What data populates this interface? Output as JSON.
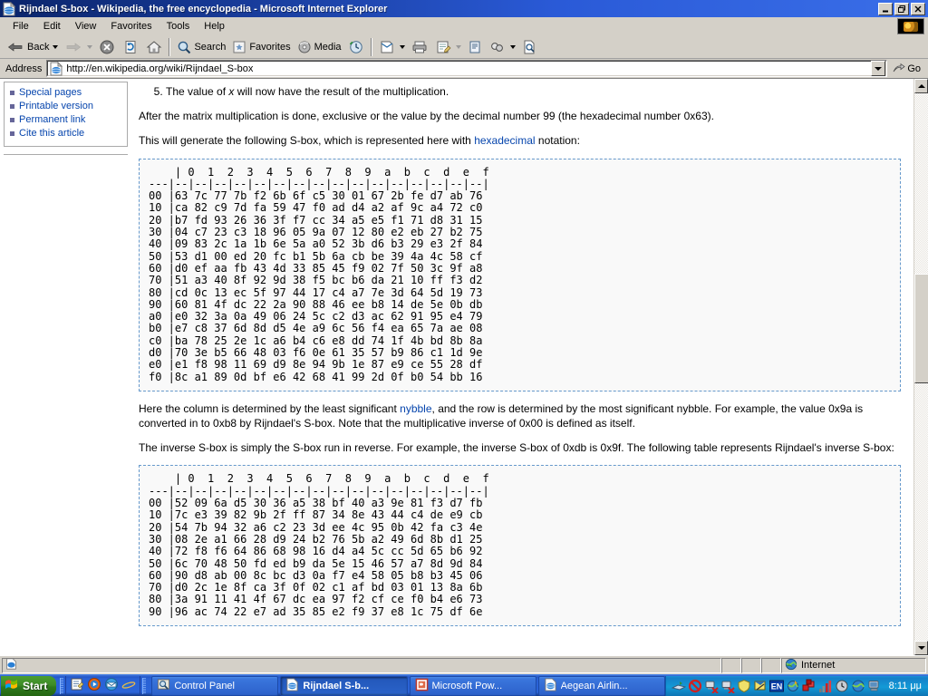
{
  "window": {
    "title": "Rijndael S-box - Wikipedia, the free encyclopedia - Microsoft Internet Explorer",
    "icon": "ie-document-icon",
    "minimize_label": "_",
    "maximize_label": "❐",
    "close_label": "✕"
  },
  "menu": {
    "items": [
      {
        "label": "File"
      },
      {
        "label": "Edit"
      },
      {
        "label": "View"
      },
      {
        "label": "Favorites"
      },
      {
        "label": "Tools"
      },
      {
        "label": "Help"
      }
    ]
  },
  "toolbar": {
    "back_label": "Back",
    "forward_label": "",
    "stop_label": "",
    "refresh_label": "",
    "home_label": "",
    "search_label": "Search",
    "favorites_label": "Favorites",
    "media_label": "Media",
    "history_label": "",
    "mail_label": "",
    "print_label": "",
    "edit_label": "",
    "discuss_label": "",
    "messenger_label": "",
    "research_label": ""
  },
  "address_bar": {
    "label": "Address",
    "url": "http://en.wikipedia.org/wiki/Rijndael_S-box",
    "placeholder": "",
    "go_label": "Go"
  },
  "sidebar": {
    "items": [
      {
        "label": "Special pages"
      },
      {
        "label": "Printable version"
      },
      {
        "label": "Permanent link"
      },
      {
        "label": "Cite this article"
      }
    ]
  },
  "article": {
    "step5_number": "5.",
    "step5_text_a": "The value of ",
    "step5_var": "x",
    "step5_text_b": " will now have the result of the multiplication.",
    "para_after_matrix": "After the matrix multiplication is done, exclusive or the value by the decimal number 99 (the hexadecimal number 0x63).",
    "para_generate_a": "This will generate the following S-box, which is represented here with ",
    "para_generate_link": "hexadecimal",
    "para_generate_b": " notation:",
    "para_column_a": "Here the column is determined by the least significant ",
    "para_column_link": "nybble",
    "para_column_b": ", and the row is determined by the most significant nybble. For example, the value 0x9a is converted in to 0xb8 by Rijndael's S-box. Note that the multiplicative inverse of 0x00 is defined as itself.",
    "para_inverse": "The inverse S-box is simply the S-box run in reverse. For example, the inverse S-box of 0xdb is 0x9f. The following table represents Rijndael's inverse S-box:",
    "sbox_text": "    | 0  1  2  3  4  5  6  7  8  9  a  b  c  d  e  f\n---|--|--|--|--|--|--|--|--|--|--|--|--|--|--|--|--|\n00 |63 7c 77 7b f2 6b 6f c5 30 01 67 2b fe d7 ab 76\n10 |ca 82 c9 7d fa 59 47 f0 ad d4 a2 af 9c a4 72 c0\n20 |b7 fd 93 26 36 3f f7 cc 34 a5 e5 f1 71 d8 31 15\n30 |04 c7 23 c3 18 96 05 9a 07 12 80 e2 eb 27 b2 75\n40 |09 83 2c 1a 1b 6e 5a a0 52 3b d6 b3 29 e3 2f 84\n50 |53 d1 00 ed 20 fc b1 5b 6a cb be 39 4a 4c 58 cf\n60 |d0 ef aa fb 43 4d 33 85 45 f9 02 7f 50 3c 9f a8\n70 |51 a3 40 8f 92 9d 38 f5 bc b6 da 21 10 ff f3 d2\n80 |cd 0c 13 ec 5f 97 44 17 c4 a7 7e 3d 64 5d 19 73\n90 |60 81 4f dc 22 2a 90 88 46 ee b8 14 de 5e 0b db\na0 |e0 32 3a 0a 49 06 24 5c c2 d3 ac 62 91 95 e4 79\nb0 |e7 c8 37 6d 8d d5 4e a9 6c 56 f4 ea 65 7a ae 08\nc0 |ba 78 25 2e 1c a6 b4 c6 e8 dd 74 1f 4b bd 8b 8a\nd0 |70 3e b5 66 48 03 f6 0e 61 35 57 b9 86 c1 1d 9e\ne0 |e1 f8 98 11 69 d9 8e 94 9b 1e 87 e9 ce 55 28 df\nf0 |8c a1 89 0d bf e6 42 68 41 99 2d 0f b0 54 bb 16",
    "inv_sbox_text": "    | 0  1  2  3  4  5  6  7  8  9  a  b  c  d  e  f\n---|--|--|--|--|--|--|--|--|--|--|--|--|--|--|--|--|\n00 |52 09 6a d5 30 36 a5 38 bf 40 a3 9e 81 f3 d7 fb\n10 |7c e3 39 82 9b 2f ff 87 34 8e 43 44 c4 de e9 cb\n20 |54 7b 94 32 a6 c2 23 3d ee 4c 95 0b 42 fa c3 4e\n30 |08 2e a1 66 28 d9 24 b2 76 5b a2 49 6d 8b d1 25\n40 |72 f8 f6 64 86 68 98 16 d4 a4 5c cc 5d 65 b6 92\n50 |6c 70 48 50 fd ed b9 da 5e 15 46 57 a7 8d 9d 84\n60 |90 d8 ab 00 8c bc d3 0a f7 e4 58 05 b8 b3 45 06\n70 |d0 2c 1e 8f ca 3f 0f 02 c1 af bd 03 01 13 8a 6b\n80 |3a 91 11 41 4f 67 dc ea 97 f2 cf ce f0 b4 e6 73\n90 |96 ac 74 22 e7 ad 35 85 e2 f9 37 e8 1c 75 df 6e"
  },
  "scrollbar": {
    "up_label": "▲",
    "down_label": "▼",
    "thumb_top_pct": 33,
    "thumb_height_pct": 20
  },
  "status_bar": {
    "message": "",
    "zone": "Internet",
    "zone_icon": "globe-icon"
  },
  "taskbar": {
    "start_label": "Start",
    "quick_launch": [
      {
        "name": "show-desktop-icon"
      },
      {
        "name": "media-player-icon"
      },
      {
        "name": "outlook-express-icon"
      },
      {
        "name": "internet-explorer-icon"
      }
    ],
    "tasks": [
      {
        "label": "Control Panel",
        "icon": "control-panel-icon",
        "active": false
      },
      {
        "label": "Rijndael S-b...",
        "icon": "ie-icon",
        "active": true
      },
      {
        "label": "Microsoft Pow...",
        "icon": "powerpoint-icon",
        "active": false
      },
      {
        "label": "Aegean Airlin...",
        "icon": "ie-icon",
        "active": false
      }
    ],
    "tray_icons": [
      {
        "name": "safely-remove-hardware-icon"
      },
      {
        "name": "blocked-icon"
      },
      {
        "name": "network-disconnected-icon"
      },
      {
        "name": "network-disconnected-2-icon"
      },
      {
        "name": "shield-icon"
      },
      {
        "name": "notes-icon"
      },
      {
        "name": "language-bar-en-icon",
        "label": "EN"
      },
      {
        "name": "antivirus-icon"
      },
      {
        "name": "red-cubes-icon"
      },
      {
        "name": "signal-bars-icon"
      },
      {
        "name": "clock-tray-icon"
      },
      {
        "name": "globe-tray-icon"
      },
      {
        "name": "monitor-icon"
      }
    ],
    "clock": "8:11 μμ"
  },
  "colors": {
    "title_bar_start": "#0a246a",
    "title_bar_end": "#3a6ee8",
    "chrome": "#d4d0c8",
    "link": "#0645ad",
    "table_border": "#6699cc",
    "table_bg": "#f9f9f9",
    "taskbar_blue": "#2458c8",
    "start_green": "#3e8c27"
  }
}
